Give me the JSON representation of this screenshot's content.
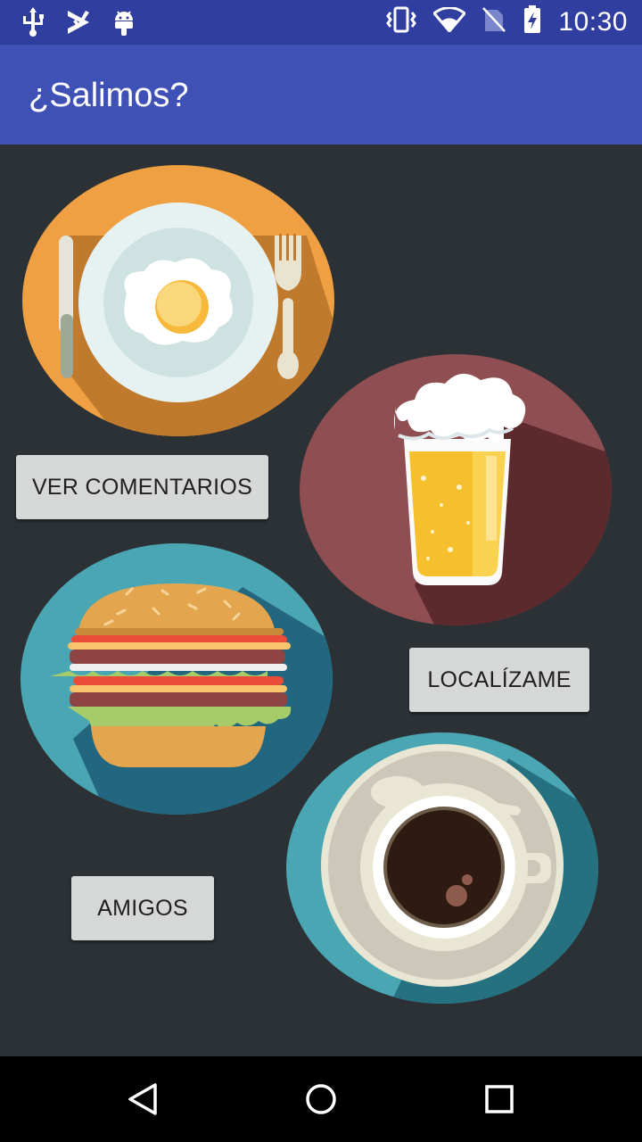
{
  "status_bar": {
    "time": "10:30",
    "left_icons": [
      "usb-icon",
      "download-icon",
      "android-debug-icon"
    ],
    "right_icons": [
      "vibrate-icon",
      "wifi-icon",
      "no-sim-icon",
      "battery-charging-icon"
    ]
  },
  "app_bar": {
    "title": "¿Salimos?",
    "color": "#3F51B5",
    "status_color": "#303F9F"
  },
  "main": {
    "background": "#2B3135",
    "buttons": {
      "comments": "VER COMENTARIOS",
      "locate": "LOCALÍZAME",
      "friends": "AMIGOS"
    },
    "illustrations": [
      "breakfast-plate-icon",
      "beer-glass-icon",
      "burger-icon",
      "coffee-cup-icon"
    ]
  },
  "nav_bar": {
    "icons": [
      "back-icon",
      "home-icon",
      "recents-icon"
    ]
  }
}
